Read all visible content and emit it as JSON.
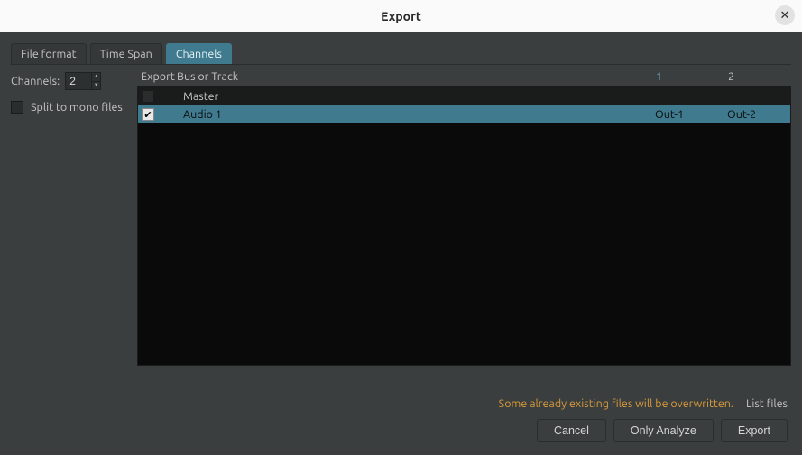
{
  "title": "Export",
  "tabs": {
    "file_format": "File format",
    "time_span": "Time Span",
    "channels": "Channels"
  },
  "active_tab": "channels",
  "left": {
    "channels_label": "Channels:",
    "channels_value": "2",
    "split_label": "Split to mono files",
    "split_checked": false
  },
  "table": {
    "headers": {
      "export": "Export",
      "bus": "Bus or Track",
      "ch1": "1",
      "ch2": "2"
    },
    "rows": [
      {
        "checked": false,
        "name": "Master",
        "ch1": "",
        "ch2": "",
        "selected": false
      },
      {
        "checked": true,
        "name": "Audio 1",
        "ch1": "Out-1",
        "ch2": "Out-2",
        "selected": true
      }
    ]
  },
  "footer": {
    "warning": "Some already existing files will be overwritten.",
    "list_files": "List files",
    "cancel": "Cancel",
    "only_analyze": "Only Analyze",
    "export": "Export"
  }
}
